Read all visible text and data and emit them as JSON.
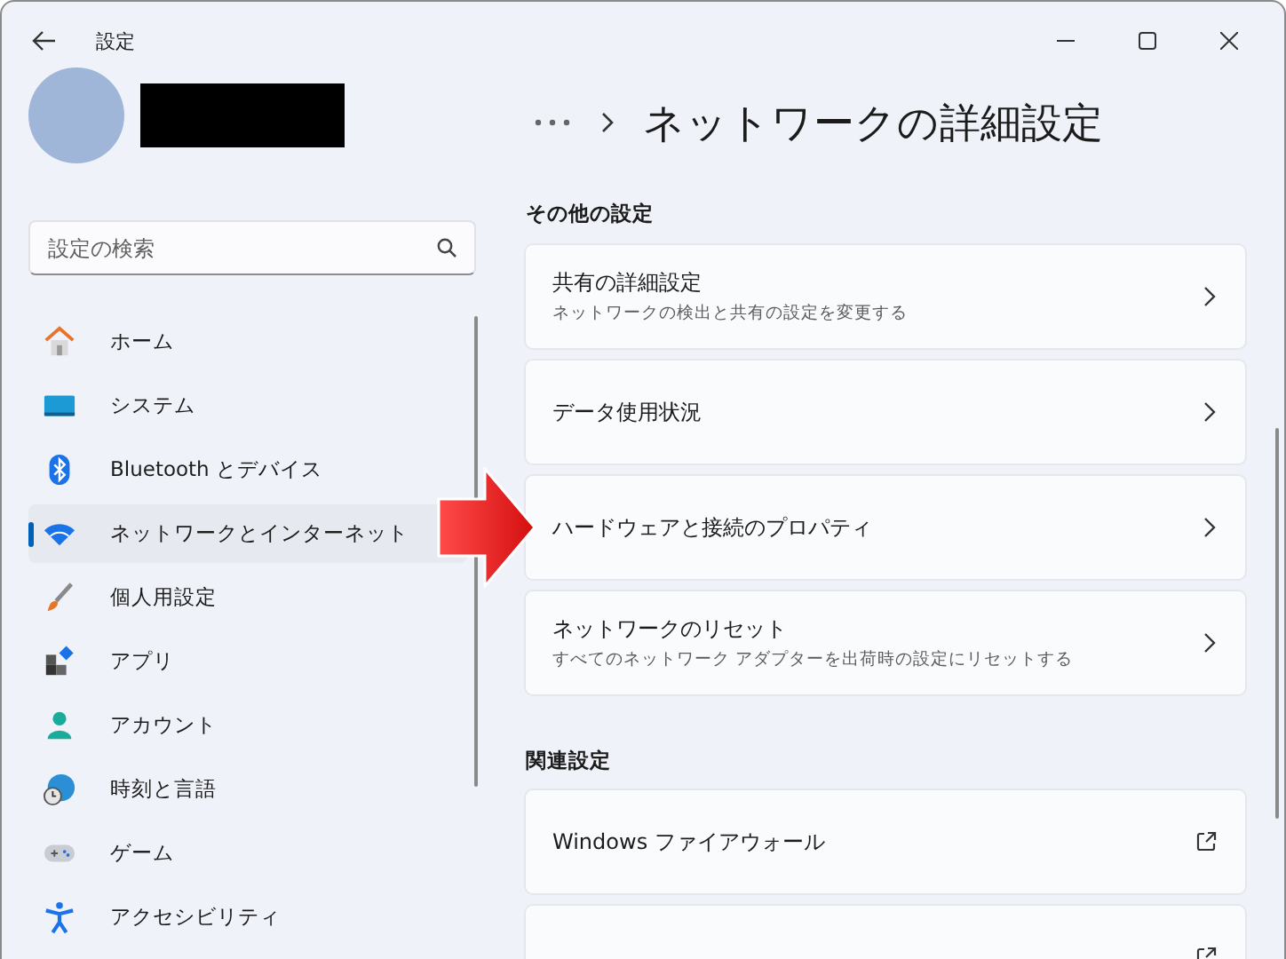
{
  "window": {
    "title": "設定"
  },
  "search": {
    "placeholder": "設定の検索"
  },
  "sidebar": {
    "items": [
      {
        "label": "ホーム",
        "kind": "home",
        "selected": false
      },
      {
        "label": "システム",
        "kind": "system",
        "selected": false
      },
      {
        "label": "Bluetooth とデバイス",
        "kind": "bluetooth",
        "selected": false
      },
      {
        "label": "ネットワークとインターネット",
        "kind": "network",
        "selected": true
      },
      {
        "label": "個人用設定",
        "kind": "brush",
        "selected": false
      },
      {
        "label": "アプリ",
        "kind": "apps",
        "selected": false
      },
      {
        "label": "アカウント",
        "kind": "account",
        "selected": false
      },
      {
        "label": "時刻と言語",
        "kind": "time",
        "selected": false
      },
      {
        "label": "ゲーム",
        "kind": "game",
        "selected": false
      },
      {
        "label": "アクセシビリティ",
        "kind": "access",
        "selected": false
      }
    ]
  },
  "page": {
    "title": "ネットワークの詳細設定",
    "sections": [
      {
        "heading": "その他の設定",
        "items": [
          {
            "title": "共有の詳細設定",
            "subtitle": "ネットワークの検出と共有の設定を変更する",
            "kind": "chevron"
          },
          {
            "title": "データ使用状況",
            "kind": "chevron"
          },
          {
            "title": "ハードウェアと接続のプロパティ",
            "kind": "chevron"
          },
          {
            "title": "ネットワークのリセット",
            "subtitle": "すべてのネットワーク アダプターを出荷時の設定にリセットする",
            "kind": "chevron"
          }
        ]
      },
      {
        "heading": "関連設定",
        "items": [
          {
            "title": "Windows ファイアウォール",
            "kind": "external"
          },
          {
            "kind": "external"
          }
        ]
      }
    ]
  }
}
